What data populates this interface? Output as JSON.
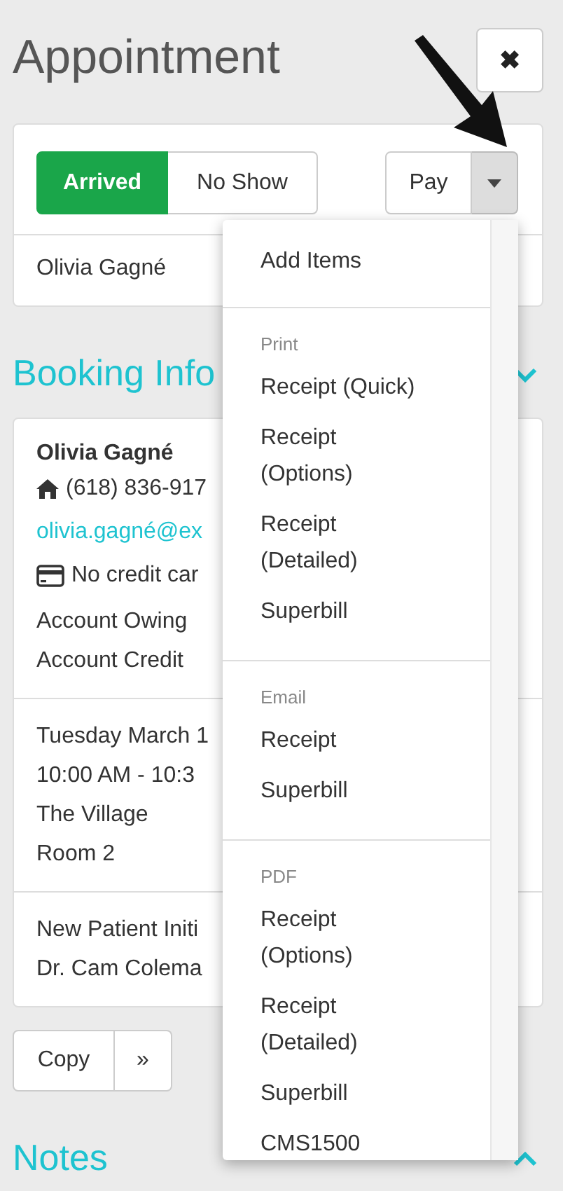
{
  "title": "Appointment",
  "close_button": {
    "label": "✖"
  },
  "status_buttons": [
    {
      "label": "Arrived",
      "selected": true
    },
    {
      "label": "No Show",
      "selected": false
    }
  ],
  "pay_button": {
    "label": "Pay"
  },
  "client_name": "Olivia Gagné",
  "booking_info": {
    "heading": "Booking Info",
    "expanded": true
  },
  "client": {
    "name": "Olivia Gagné",
    "phone": "(618) 836-917",
    "email": "olivia.gagné@ex",
    "card": "No credit car",
    "lines": [
      "Account Owing",
      "Account Credit"
    ]
  },
  "appointment": [
    "Tuesday March 1",
    "10:00 AM - 10:3",
    "The Village",
    "Room 2"
  ],
  "service": [
    "New Patient Initi",
    "Dr. Cam Colema"
  ],
  "copy_button": {
    "label": "Copy",
    "more": "»"
  },
  "notes": {
    "heading": "Notes",
    "expanded": false
  },
  "dropdown": [
    {
      "items": [
        "Add Items"
      ]
    },
    {
      "header": "Print",
      "items": [
        "Receipt (Quick)",
        "Receipt (Options)",
        "Receipt (Detailed)",
        "Superbill"
      ]
    },
    {
      "header": "Email",
      "items": [
        "Receipt",
        "Superbill"
      ]
    },
    {
      "header": "PDF",
      "items": [
        "Receipt (Options)",
        "Receipt (Detailed)",
        "Superbill",
        "CMS1500"
      ]
    }
  ]
}
